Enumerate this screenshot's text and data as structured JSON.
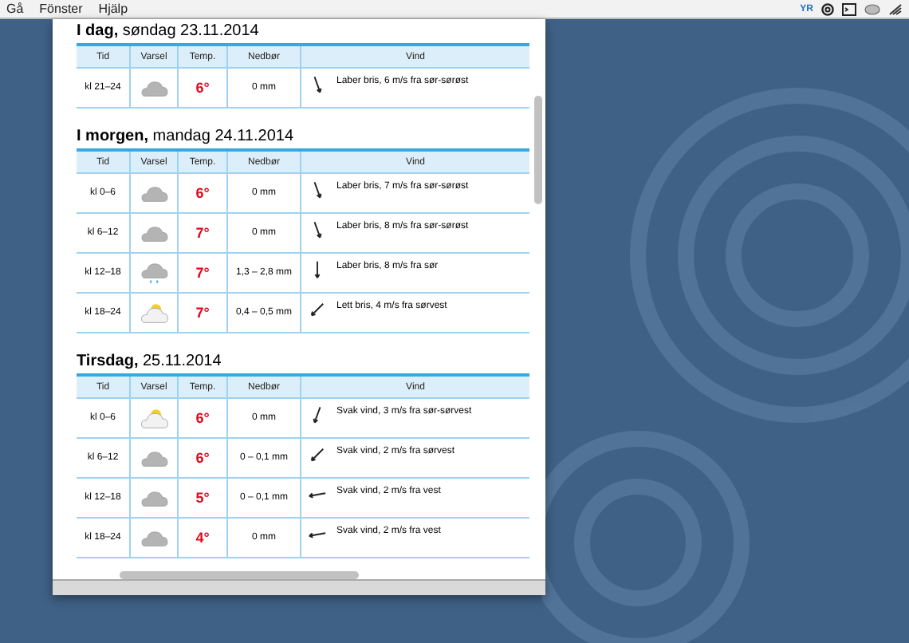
{
  "menu": [
    "Gå",
    "Fönster",
    "Hjälp"
  ],
  "status_icons": {
    "logo": "YR"
  },
  "days": [
    {
      "title_bold": "I dag,",
      "title_rest": "søndag 23.11.2014",
      "columns": [
        "Tid",
        "Varsel",
        "Temp.",
        "Nedbør",
        "Vind"
      ],
      "rows": [
        {
          "time": "kl 21–24",
          "kind": "cloud",
          "temp": "6°",
          "precip": "0 mm",
          "arrow": {
            "kind": "sse"
          },
          "wind": "Laber bris, 6 m/s fra sør-sørøst"
        }
      ]
    },
    {
      "title_bold": "I morgen,",
      "title_rest": "mandag 24.11.2014",
      "columns": [
        "Tid",
        "Varsel",
        "Temp.",
        "Nedbør",
        "Vind"
      ],
      "rows": [
        {
          "time": "kl 0–6",
          "kind": "cloud",
          "temp": "6°",
          "precip": "0 mm",
          "arrow": {
            "kind": "sse"
          },
          "wind": "Laber bris, 7 m/s fra sør-sørøst"
        },
        {
          "time": "kl 6–12",
          "kind": "cloud",
          "temp": "7°",
          "precip": "0 mm",
          "arrow": {
            "kind": "sse"
          },
          "wind": "Laber bris, 8 m/s fra sør-sørøst"
        },
        {
          "time": "kl 12–18",
          "kind": "rain",
          "temp": "7°",
          "precip": "1,3 – 2,8 mm",
          "arrow": {
            "kind": "s"
          },
          "wind": "Laber bris, 8 m/s fra sør"
        },
        {
          "time": "kl 18–24",
          "kind": "partsun",
          "temp": "7°",
          "precip": "0,4 – 0,5 mm",
          "arrow": {
            "kind": "sw"
          },
          "wind": "Lett bris, 4 m/s fra sørvest"
        }
      ]
    },
    {
      "title_bold": "Tirsdag,",
      "title_rest": "25.11.2014",
      "columns": [
        "Tid",
        "Varsel",
        "Temp.",
        "Nedbør",
        "Vind"
      ],
      "rows": [
        {
          "time": "kl 0–6",
          "kind": "partsun",
          "temp": "6°",
          "precip": "0 mm",
          "arrow": {
            "kind": "ssw"
          },
          "wind": "Svak vind, 3 m/s fra sør-sørvest"
        },
        {
          "time": "kl 6–12",
          "kind": "cloud",
          "temp": "6°",
          "precip": "0 – 0,1 mm",
          "arrow": {
            "kind": "sw"
          },
          "wind": "Svak vind, 2 m/s fra sørvest"
        },
        {
          "time": "kl 12–18",
          "kind": "cloud",
          "temp": "5°",
          "precip": "0 – 0,1 mm",
          "arrow": {
            "kind": "w"
          },
          "wind": "Svak vind, 2 m/s fra vest"
        },
        {
          "time": "kl 18–24",
          "kind": "cloud",
          "temp": "4°",
          "precip": "0 mm",
          "arrow": {
            "kind": "w"
          },
          "wind": "Svak vind, 2 m/s fra vest"
        }
      ]
    }
  ]
}
